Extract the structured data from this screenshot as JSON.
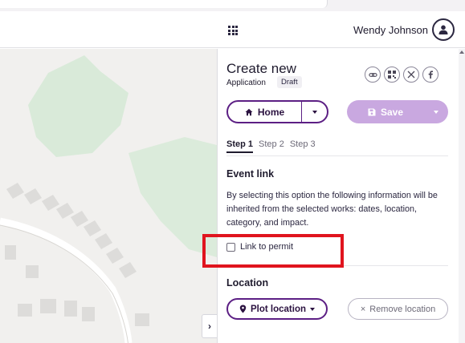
{
  "header": {
    "user_name": "Wendy Johnson",
    "apps_icon": "apps-grid-icon",
    "avatar_icon": "person-icon"
  },
  "map": {
    "toggle_label": "›",
    "colors": {
      "land": "#f1f0ee",
      "park": "#d9ead9",
      "building": "#dddcda",
      "road": "#ffffff"
    }
  },
  "panel": {
    "title": "Create new",
    "subtitle": "Application",
    "badge": "Draft",
    "share_icons": [
      "link-icon",
      "qr-code-icon",
      "x-icon",
      "facebook-icon"
    ],
    "home_button": {
      "icon": "home-icon",
      "label": "Home"
    },
    "save_button": {
      "icon": "save-icon",
      "label": "Save"
    },
    "tabs": [
      {
        "label": "Step 1",
        "active": true
      },
      {
        "label": "Step 2",
        "active": false
      },
      {
        "label": "Step 3",
        "active": false
      }
    ],
    "event_link": {
      "title": "Event link",
      "description": "By selecting this option the following information will be inherited from the selected works: dates, location, category, and impact.",
      "checkbox_label": "Link to permit",
      "checked": false
    },
    "location": {
      "title": "Location",
      "plot_button": {
        "icon": "map-pin-icon",
        "label": "Plot location"
      },
      "remove_button": {
        "icon": "close-icon",
        "label": "Remove location"
      }
    }
  },
  "colors": {
    "accent": "#5c1f84",
    "save_disabled": "#c9a8e0",
    "highlight": "#e0141e"
  }
}
